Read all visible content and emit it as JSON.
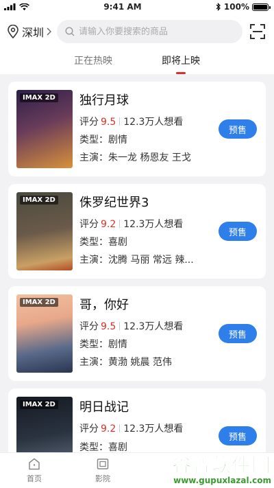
{
  "status_bar": {
    "time": "9:41 AM",
    "battery": "100%"
  },
  "header": {
    "city": "深圳",
    "search_placeholder": "请输入你要搜索的商品",
    "icons": [
      "location-pin-icon",
      "chevron-right-icon",
      "search-icon",
      "scan-icon"
    ]
  },
  "tabs": [
    {
      "label": "正在热映",
      "active": false
    },
    {
      "label": "即将上映",
      "active": true
    }
  ],
  "labels": {
    "rating": "评分",
    "genre": "类型：",
    "cast": "主演：",
    "buy": "预售"
  },
  "movies": [
    {
      "title": "独行月球",
      "badge": "IMAX 2D",
      "rating": "9.5",
      "want": "12.3万人想看",
      "genre": "剧情",
      "cast": "朱一龙 杨恩友 王戈",
      "poster_colors": [
        "#3a2a5a",
        "#d8913a"
      ]
    },
    {
      "title": "侏罗纪世界3",
      "badge": "IMAX 2D",
      "rating": "9.2",
      "want": "12.3万人想看",
      "genre": "喜剧",
      "cast": "沈腾 马丽 常远 辣...",
      "poster_colors": [
        "#6b5a4a",
        "#c9a064"
      ]
    },
    {
      "title": "哥，你好",
      "badge": "IMAX 2D",
      "rating": "9.5",
      "want": "12.3万人想看",
      "genre": "剧情",
      "cast": "黄渤 姚晨 范伟",
      "poster_colors": [
        "#e8a88a",
        "#3a4a6a"
      ]
    },
    {
      "title": "明日战记",
      "badge": "IMAX 2D",
      "rating": "9.2",
      "want": "12.3万人想看",
      "genre": "喜剧",
      "cast": "",
      "poster_colors": [
        "#1e2530",
        "#6a7585"
      ]
    }
  ],
  "bottom_nav": [
    {
      "label": "首页",
      "icon": "home-icon"
    },
    {
      "label": "影院",
      "icon": "film-icon"
    }
  ],
  "watermark": {
    "main": "谷普软件园",
    "url": "www.gupuxlazal.com"
  },
  "colors": {
    "accent_red": "#e02e24",
    "button_blue": "#2f7fea",
    "background": "#f2f2f4"
  }
}
